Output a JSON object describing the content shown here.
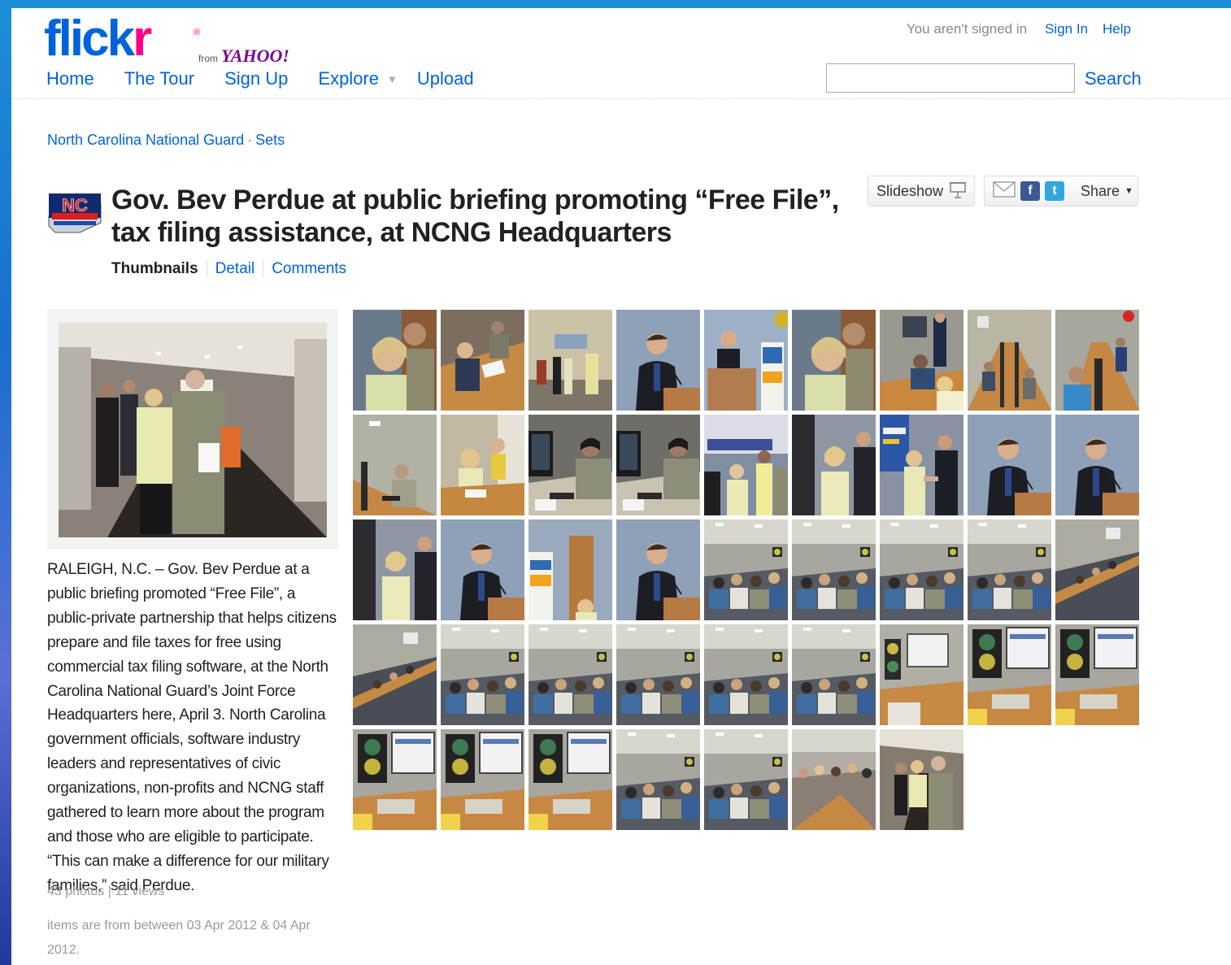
{
  "header": {
    "logo_text_a": "flick",
    "logo_text_b": "r",
    "logo_from": "from",
    "logo_yahoo": "YAHOO!",
    "nav": {
      "home": "Home",
      "tour": "The Tour",
      "signup": "Sign Up",
      "explore": "Explore",
      "upload": "Upload"
    },
    "status": "You aren't signed in",
    "sign_in": "Sign In",
    "help": "Help",
    "search_button": "Search",
    "search_value": ""
  },
  "breadcrumb": {
    "owner": "North Carolina National Guard",
    "separator": "·",
    "section": "Sets"
  },
  "set": {
    "title": "Gov. Bev Perdue at public briefing promoting “Free File”, tax filing assistance, at NCNG Headquarters",
    "slideshow": "Slideshow",
    "share": "Share",
    "tabs": {
      "thumbnails": "Thumbnails",
      "detail": "Detail",
      "comments": "Comments"
    },
    "description": "RALEIGH, N.C. – Gov. Bev Perdue at a public briefing promoted “Free File”, a public-private partnership that helps citizens prepare and file taxes for free using commercial tax filing software, at the North Carolina National Guard’s Joint Force Headquarters here, April 3. North Carolina government officials, software industry leaders and representatives of civic organizations, non-profits and NCNG staff gathered to learn more about the program and those who are eligible to participate. “This can make a difference for our military families,” said Perdue.",
    "stats": "43 photos | 11 views",
    "date_range": "items are from between 03 Apr 2012 & 04 Apr 2012."
  },
  "icons": {
    "slideshow": "projector-screen-icon",
    "email": "envelope-icon",
    "facebook": "facebook-icon",
    "twitter": "twitter-icon",
    "share_caret": "caret-down-icon",
    "explore_caret": "caret-down-icon"
  },
  "thumbnails": [
    "close-up-governor-and-officer",
    "briefing-table-writing",
    "hall-podium-people",
    "speaker-at-podium",
    "speaker-podium-free-file-banner",
    "close-up-governor-and-officer",
    "computer-desk-signing",
    "computer-lab-rows",
    "computer-lab-attendees",
    "computer-lab-workstations",
    "governor-writing-at-desk",
    "soldier-at-computer",
    "soldier-at-computer",
    "emergency-ops-banner-group",
    "governor-in-crowd",
    "handshake-your-taxes-free",
    "speaker-at-podium",
    "speaker-at-podium",
    "governor-in-crowd",
    "speaker-at-podium",
    "free-file-banner",
    "speaker-at-podium",
    "briefing-room-audience",
    "briefing-room-audience",
    "briefing-room-audience",
    "briefing-room-audience",
    "briefing-room-tables",
    "briefing-room-tables",
    "briefing-room-audience",
    "briefing-room-audience",
    "briefing-room-audience",
    "briefing-room-audience",
    "briefing-room-audience",
    "briefing-room-projection",
    "emblem-and-screen",
    "emblem-and-screen",
    "emblem-and-screen",
    "emblem-and-screen",
    "emblem-and-screen",
    "briefing-room-audience",
    "briefing-room-audience",
    "briefing-room-crowd",
    "governor-walking-hall"
  ],
  "colors": {
    "link": "#0063dc",
    "flickr_blue": "#0063dc",
    "flickr_pink": "#ff0084",
    "yahoo_purple": "#7b0099"
  }
}
